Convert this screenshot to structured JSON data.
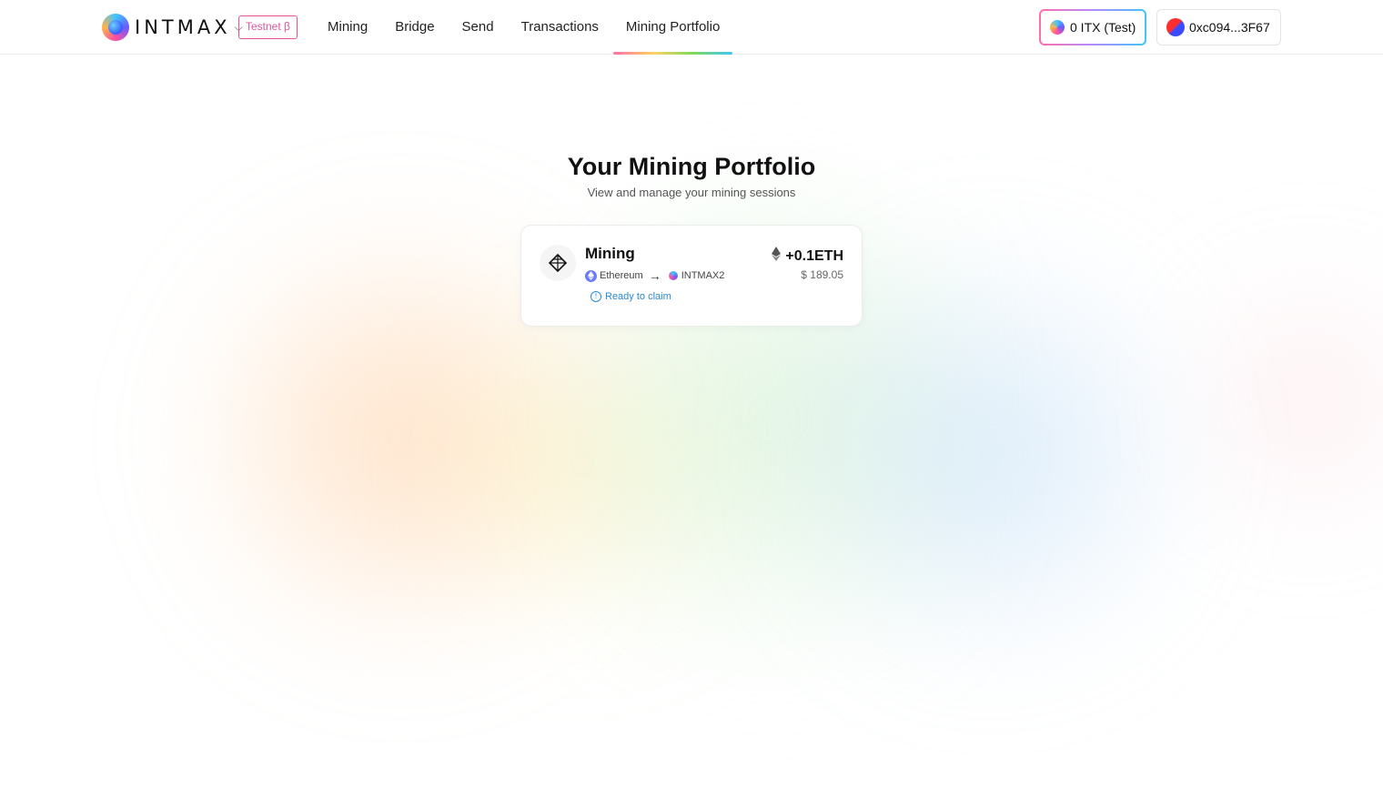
{
  "header": {
    "logo_text": "INTMAX",
    "badge": "Testnet β",
    "nav": [
      {
        "label": "Mining"
      },
      {
        "label": "Bridge"
      },
      {
        "label": "Send"
      },
      {
        "label": "Transactions"
      },
      {
        "label": "Mining Portfolio",
        "active": true
      }
    ],
    "balance_label": "0 ITX (Test)",
    "wallet_address": "0xc094...3F67"
  },
  "main": {
    "title": "Your Mining Portfolio",
    "subtitle": "View and manage your mining sessions",
    "cards": [
      {
        "title": "Mining",
        "from_network": "Ethereum",
        "to_network": "INTMAX2",
        "status": "Ready to claim",
        "amount": "+0.1ETH",
        "usd_value": "$ 189.05",
        "icon": "diamond-icon"
      }
    ]
  },
  "colors": {
    "accent_pink": "#e0559e",
    "status_blue": "#2a8ad6",
    "eth_purple": "#6b7cff"
  }
}
